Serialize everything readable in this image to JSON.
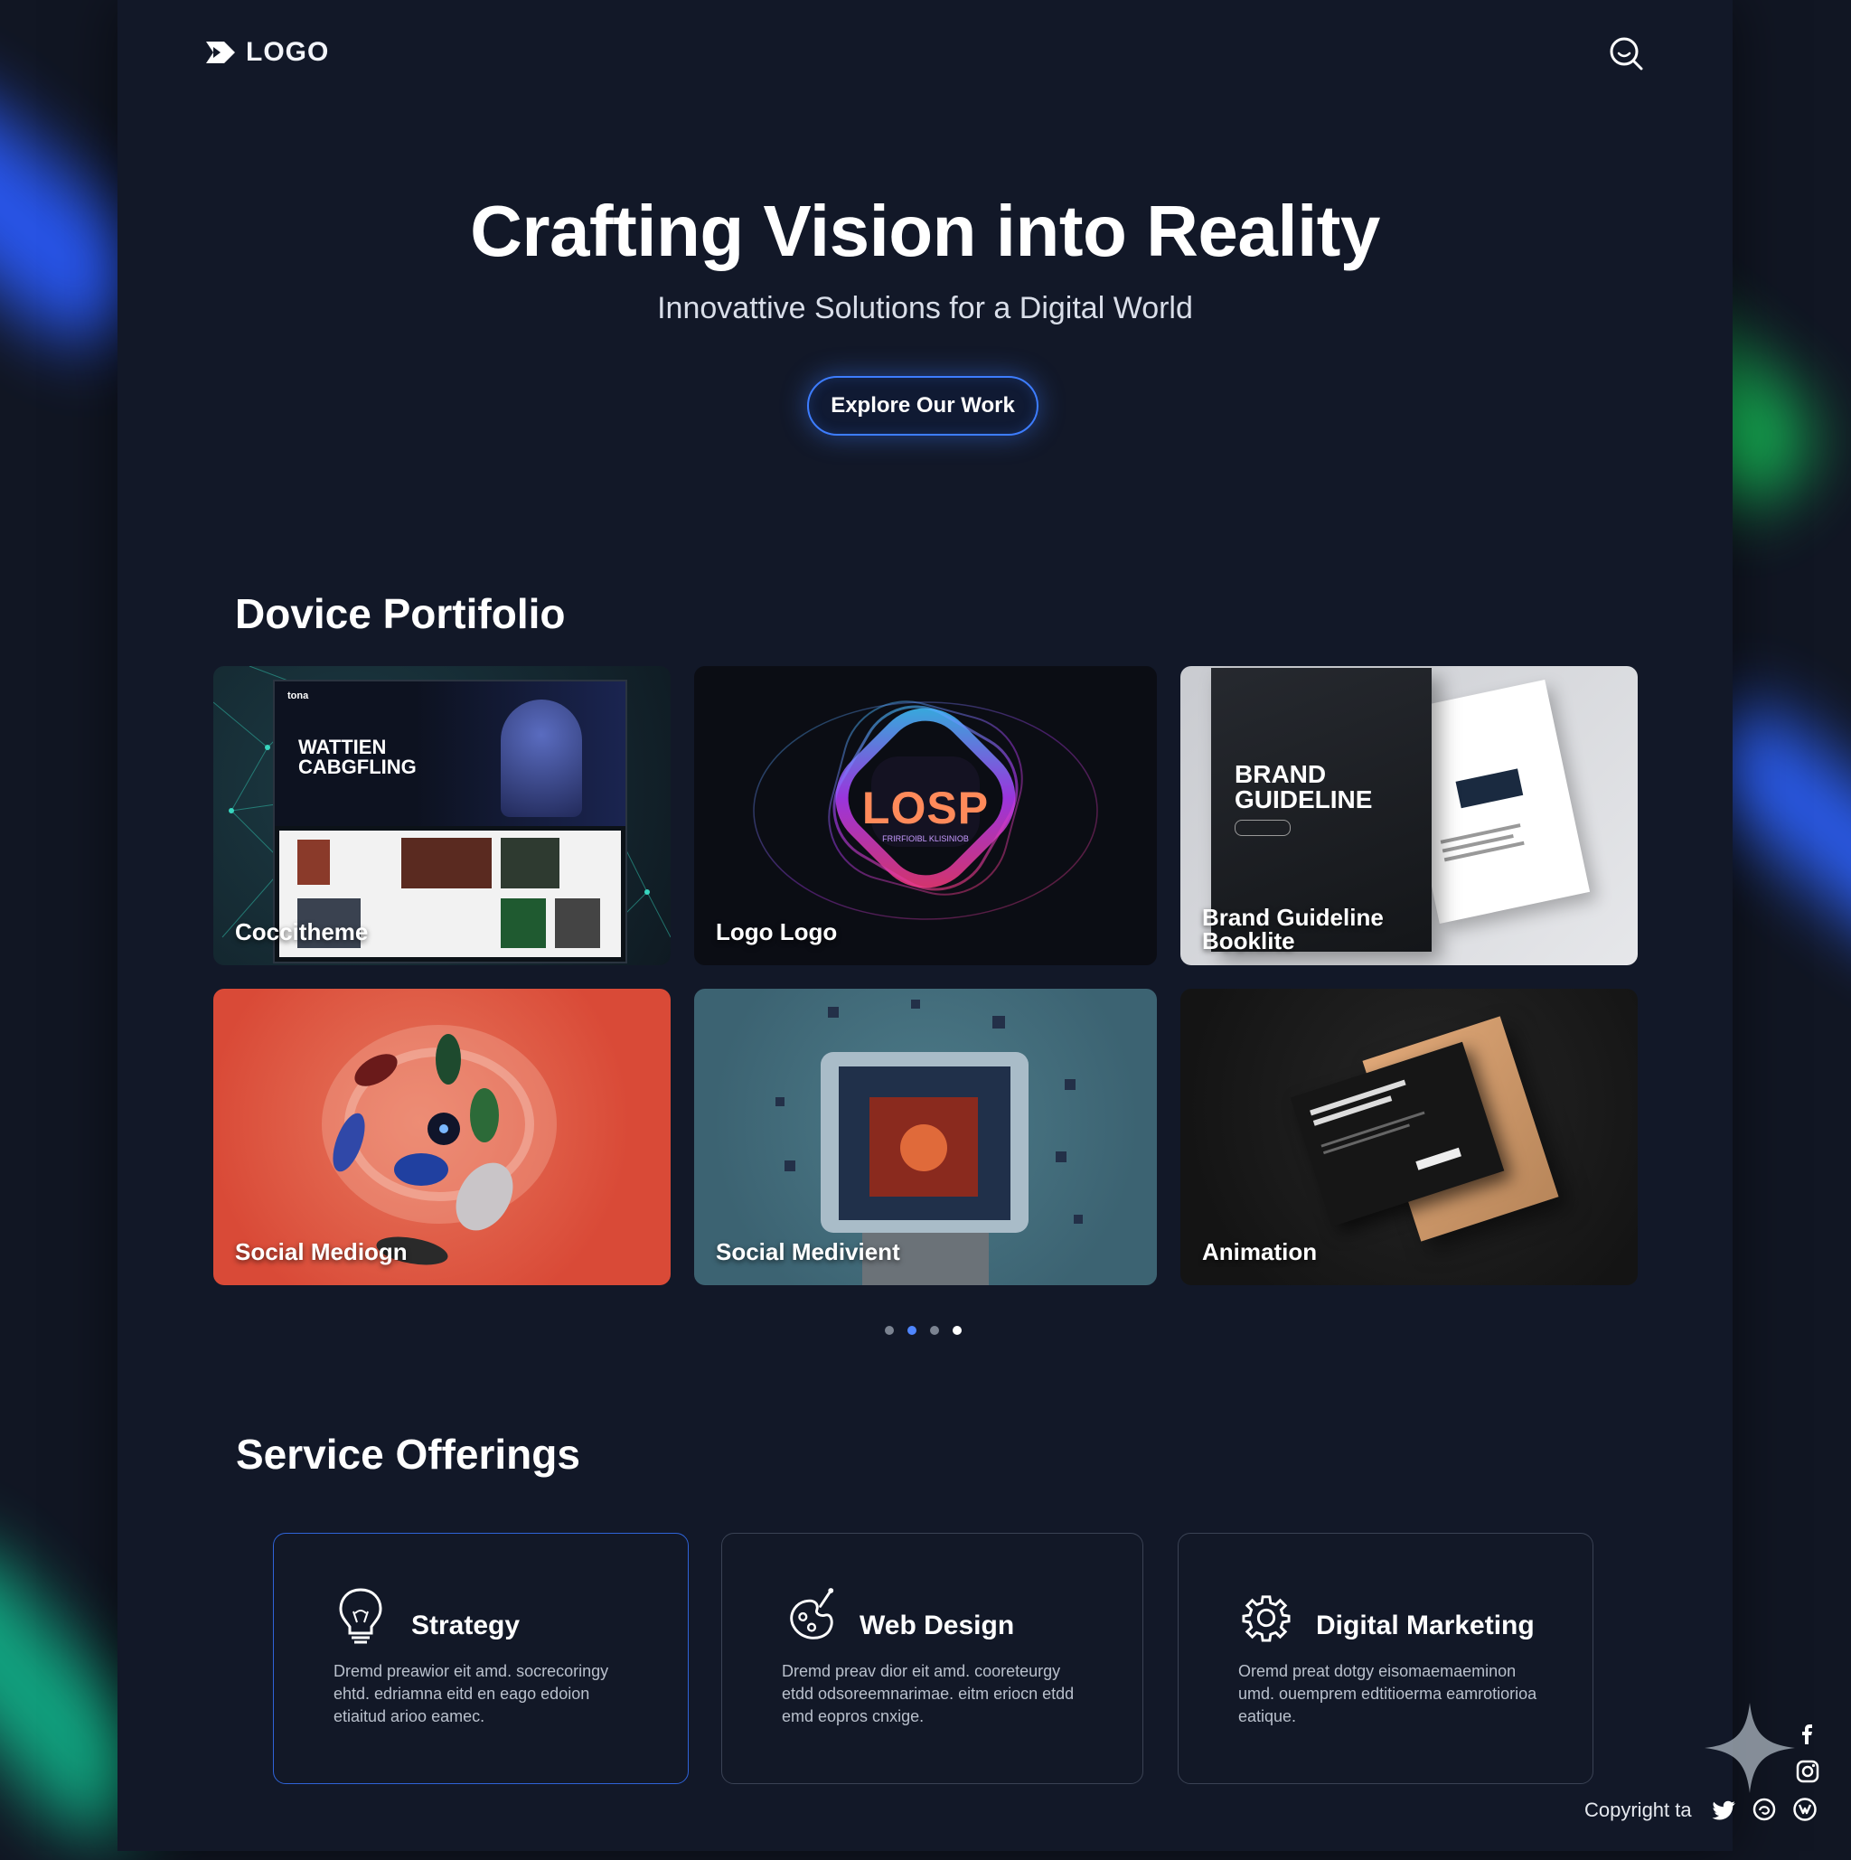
{
  "brand": {
    "logo_text": "LOGO"
  },
  "header": {
    "search_icon": "search-icon"
  },
  "hero": {
    "title": "Crafting Vision into Reality",
    "subtitle": "Innovattive Solutions for a Digital World",
    "cta_label": "Explore Our Work"
  },
  "portfolio": {
    "title": "Dovice Portifolio",
    "items": [
      {
        "label": "Coccitheme",
        "mock_title_1": "WATTIEN",
        "mock_title_2": "CABGFLING",
        "mock_brand": "tona"
      },
      {
        "label": "Logo Logo",
        "mark_text": "LOSP",
        "mark_sub": "FRIRFIOIBL KLISINIOB"
      },
      {
        "label_1": "Brand Guideline",
        "label_2": "Booklite",
        "cover_1": "BRAND",
        "cover_2": "GUIDELINE"
      },
      {
        "label": "Social Mediogn"
      },
      {
        "label": "Social Medivient"
      },
      {
        "label": "Animation"
      }
    ],
    "pagination": {
      "count": 4,
      "active_index": 1
    }
  },
  "services": {
    "title": "Service Offerings",
    "items": [
      {
        "title": "Strategy",
        "icon": "lightbulb-icon",
        "description": "Dremd preawior eit amd. socrecoringy ehtd. edriamna eitd en eago edoion etiaitud arioo eamec."
      },
      {
        "title": "Web Design",
        "icon": "palette-icon",
        "description": "Dremd preav dior eit amd. cooreteurgy etdd odsoreemnarimae. eitm eriocn etdd emd eopros cnxige."
      },
      {
        "title": "Digital Marketing",
        "icon": "gear-icon",
        "description": "Oremd preat dotgy eisomaemaeminon umd. ouemprem edtitioerma eamrotiorioa eatique."
      }
    ]
  },
  "footer": {
    "copyright": "Copyright ta",
    "social": [
      "facebook-icon",
      "instagram-icon",
      "twitter-icon",
      "threads-icon",
      "vk-icon"
    ]
  },
  "colors": {
    "accent": "#3d7dff",
    "background": "#121828",
    "glow_blue": "#2b5cff",
    "glow_green": "#17c25a"
  }
}
